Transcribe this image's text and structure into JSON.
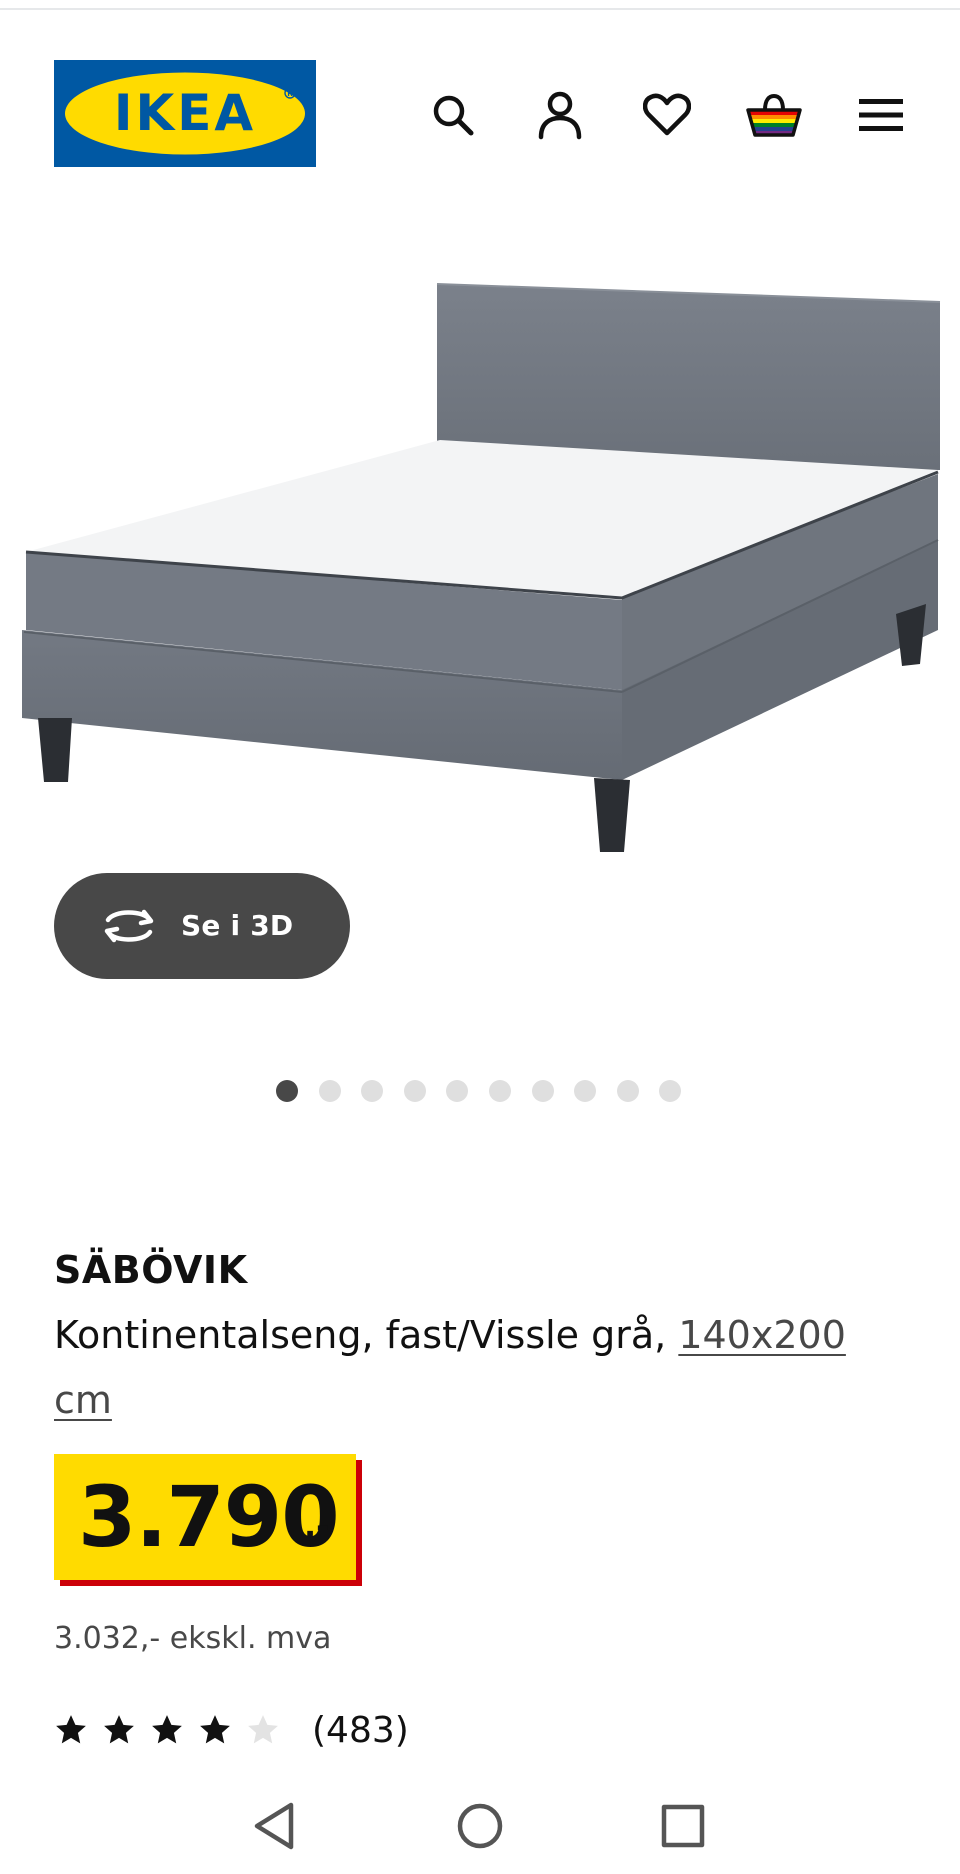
{
  "header": {
    "logo_text": "IKEA",
    "logo_colors": {
      "blue": "#0058a3",
      "yellow": "#ffdb00"
    },
    "icons": [
      "search-icon",
      "account-icon",
      "wishlist-heart-icon",
      "shopping-bag-icon",
      "menu-icon"
    ]
  },
  "gallery": {
    "view_3d_label": "Se i 3D",
    "dot_count": 10,
    "active_dot": 1
  },
  "product": {
    "name": "SÄBÖVIK",
    "description": "Kontinentalseng, fast/Vissle grå, ",
    "size_link": "140x200 cm",
    "price_integer": "3.790",
    "price_suffix": ",-",
    "price_excl_vat": "3.032,- ekskl. mva",
    "rating_value": 4,
    "rating_max": 5,
    "review_count": "(483)"
  },
  "colors": {
    "price_yellow": "#ffdb00",
    "price_red": "#cc0008",
    "dark_grey": "#484848",
    "dot_inactive": "#dfdfdf"
  },
  "system_nav": [
    "back-icon",
    "home-icon",
    "recents-icon"
  ]
}
